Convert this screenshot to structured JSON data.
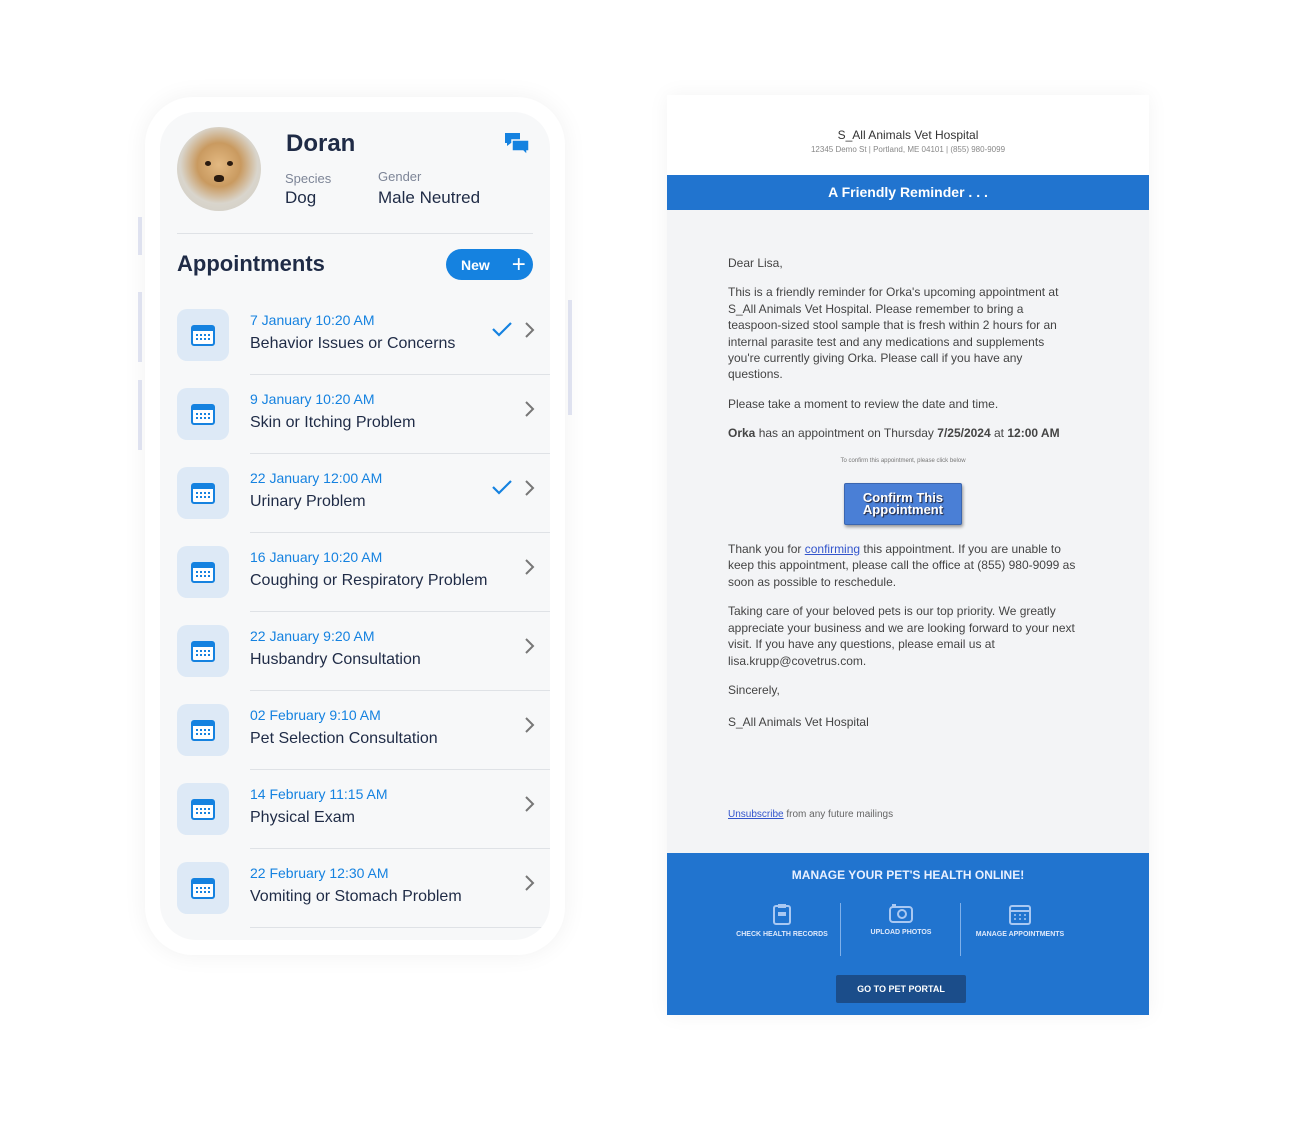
{
  "pet": {
    "name": "Doran",
    "species_label": "Species",
    "species": "Dog",
    "gender_label": "Gender",
    "gender": "Male Neutred"
  },
  "appointments": {
    "title": "Appointments",
    "new_label": "New",
    "items": [
      {
        "date": "7 January 10:20 AM",
        "reason": "Behavior Issues or Concerns",
        "confirmed": true
      },
      {
        "date": "9 January 10:20 AM",
        "reason": "Skin or Itching Problem",
        "confirmed": false
      },
      {
        "date": "22 January 12:00 AM",
        "reason": "Urinary Problem",
        "confirmed": true
      },
      {
        "date": "16 January 10:20 AM",
        "reason": "Coughing or Respiratory Problem",
        "confirmed": false
      },
      {
        "date": "22 January 9:20 AM",
        "reason": "Husbandry Consultation",
        "confirmed": false
      },
      {
        "date": "02 February 9:10 AM",
        "reason": "Pet Selection Consultation",
        "confirmed": false
      },
      {
        "date": "14 February 11:15 AM",
        "reason": "Physical Exam",
        "confirmed": false
      },
      {
        "date": "22 February 12:30 AM",
        "reason": "Vomiting or Stomach Problem",
        "confirmed": false
      }
    ]
  },
  "email": {
    "hospital": "S_All Animals Vet Hospital",
    "address": "12345 Demo St | Portland, ME 04101 | (855) 980-9099",
    "banner": "A Friendly Reminder . . .",
    "greeting": "Dear Lisa,",
    "p1": "This is a friendly reminder for Orka's upcoming appointment at S_All Animals Vet Hospital. Please remember to bring a teaspoon-sized stool sample that is fresh within 2 hours for an internal parasite test and any medications and supplements you're currently giving Orka.   Please call if you have any questions.",
    "p2": "Please take a moment to review the date and time.",
    "appt_pet": "Orka",
    "appt_mid": " has an appointment on Thursday ",
    "appt_date": "7/25/2024",
    "appt_at": " at ",
    "appt_time": "12:00 AM",
    ".": ".",
    "confirm_hint": "To confirm this appointment, please click below",
    "confirm_button": "Confirm This Appointment",
    "p3_a": "Thank you for ",
    "p3_link": "confirming",
    "p3_b": " this appointment. If you are unable to keep this appointment, please call the office at (855) 980-9099 as soon as possible to reschedule.",
    "p4": "Taking care of your beloved pets is our top priority. We greatly appreciate your business and we are looking forward to your next visit. If you have any questions, please email us at lisa.krupp@covetrus.com.",
    "signoff": "Sincerely,",
    "signature": "S_All Animals Vet Hospital",
    "unsubscribe_link": "Unsubscribe",
    "unsubscribe_text": " from any future mailings",
    "footer": {
      "title": "MANAGE YOUR PET'S HEALTH ONLINE!",
      "features": [
        {
          "label": "CHECK HEALTH RECORDS",
          "icon": "clipboard-icon"
        },
        {
          "label": "UPLOAD PHOTOS",
          "icon": "camera-icon"
        },
        {
          "label": "MANAGE APPOINTMENTS",
          "icon": "calendar-icon"
        }
      ],
      "portal_button": "GO TO PET PORTAL"
    }
  },
  "colors": {
    "accent": "#1582e0",
    "email_blue": "#2174cf",
    "text_dark": "#1f2b46"
  }
}
